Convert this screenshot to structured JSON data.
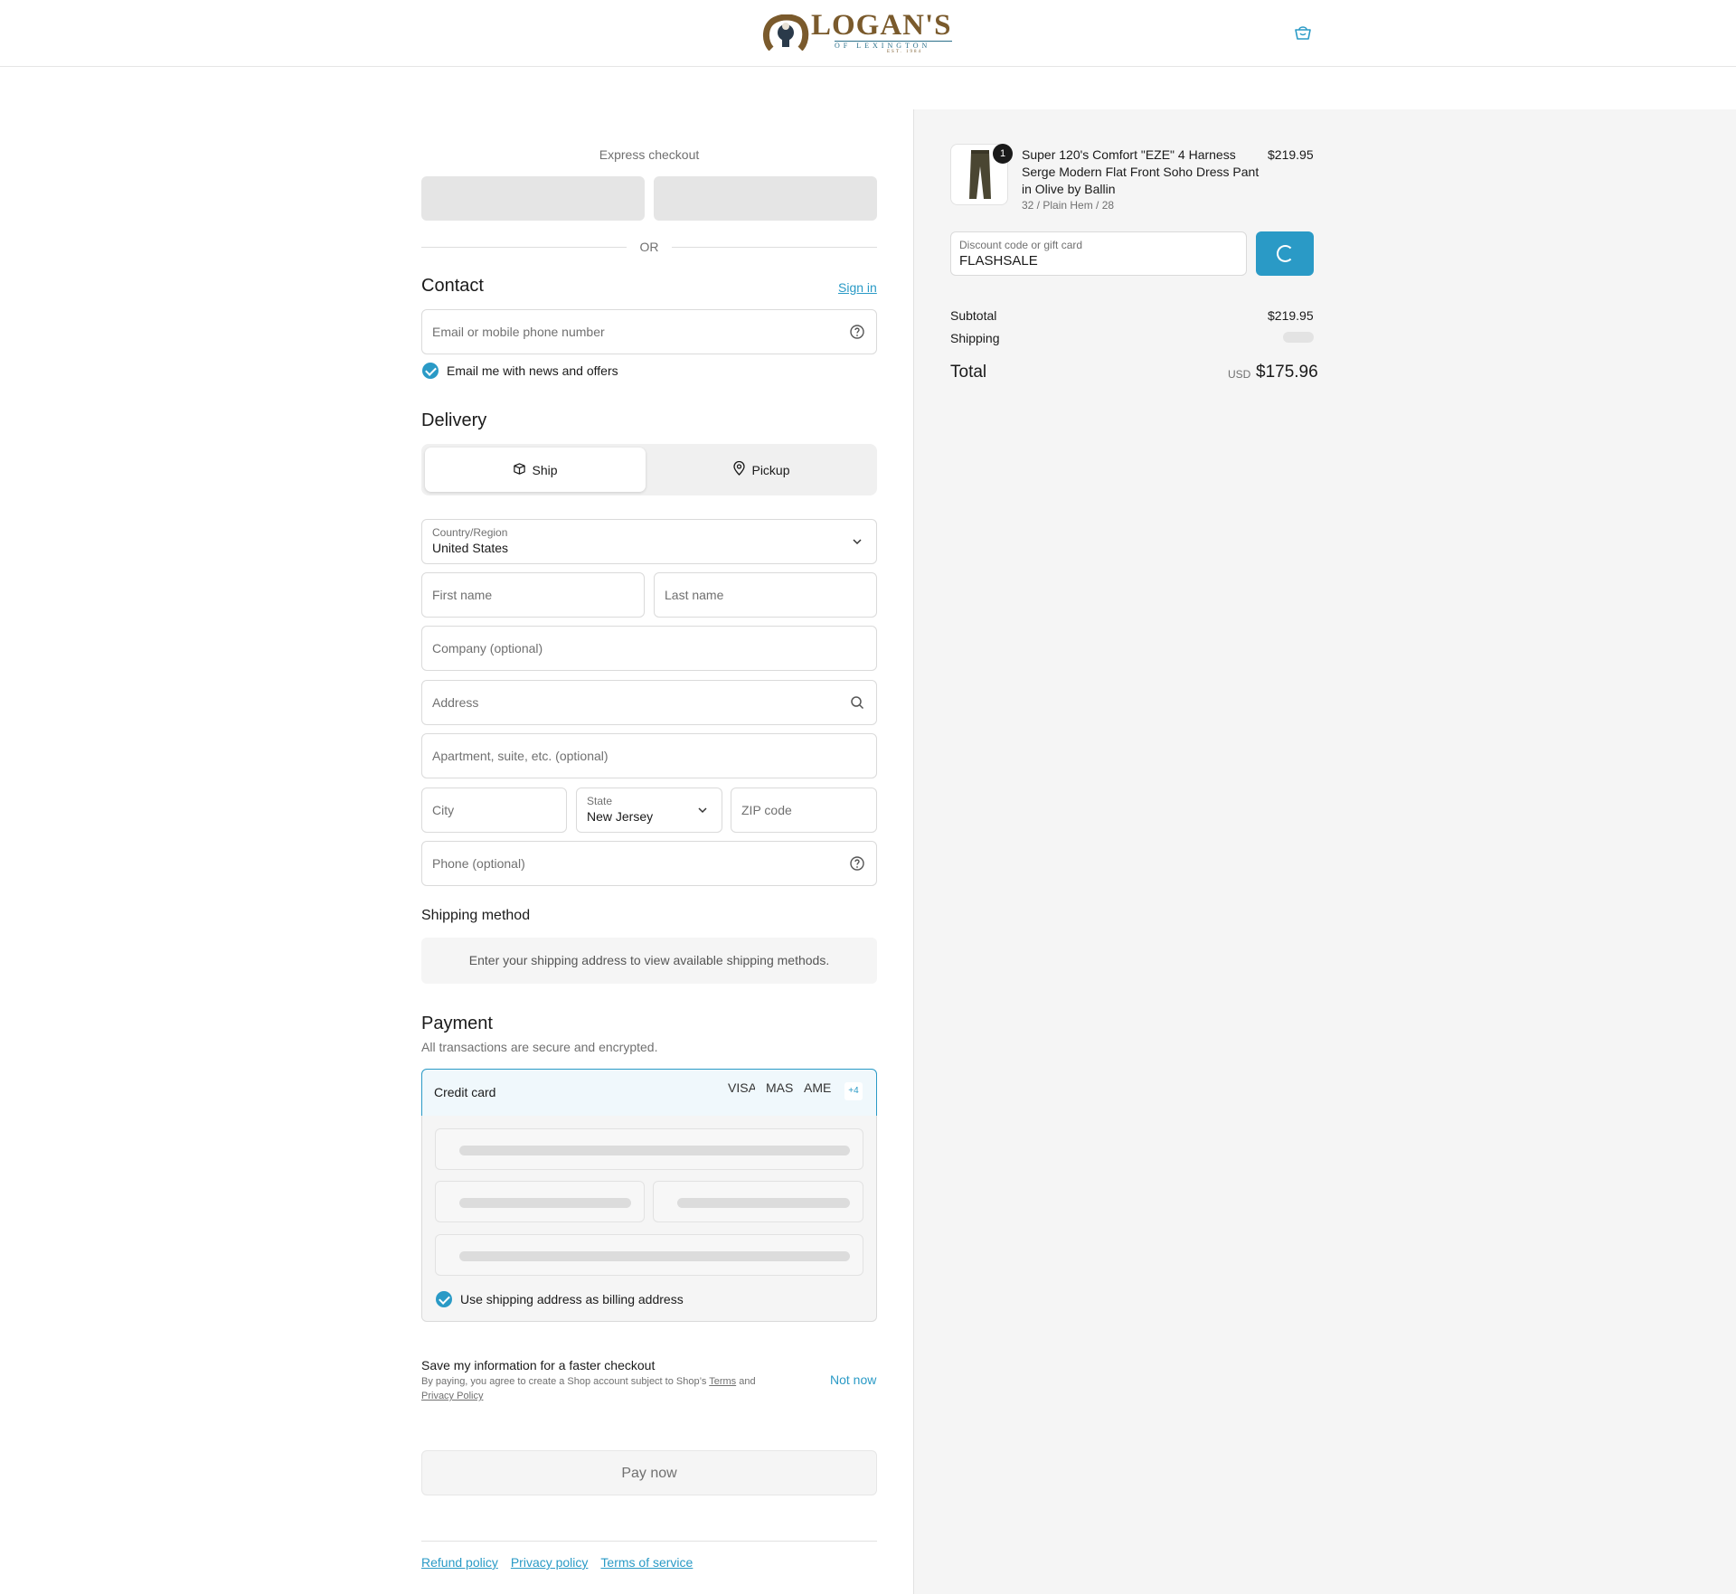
{
  "header": {
    "logo": {
      "main": "LOGAN'S",
      "sub": "OF LEXINGTON",
      "est": "EST. 1984"
    },
    "cart_icon": "cart-icon"
  },
  "express": {
    "title": "Express checkout",
    "or": "OR"
  },
  "contact": {
    "title": "Contact",
    "sign_in": "Sign in",
    "email_placeholder": "Email or mobile phone number",
    "newsletter_label": "Email me with news and offers",
    "newsletter_checked": true
  },
  "delivery": {
    "title": "Delivery",
    "ship_label": "Ship",
    "pickup_label": "Pickup",
    "selected": "Ship",
    "country_label": "Country/Region",
    "country_value": "United States",
    "first_name_placeholder": "First name",
    "last_name_placeholder": "Last name",
    "company_placeholder": "Company (optional)",
    "address_placeholder": "Address",
    "apartment_placeholder": "Apartment, suite, etc. (optional)",
    "city_placeholder": "City",
    "state_label": "State",
    "state_value": "New Jersey",
    "zip_placeholder": "ZIP code",
    "phone_placeholder": "Phone (optional)"
  },
  "shipping_method": {
    "title": "Shipping method",
    "message": "Enter your shipping address to view available shipping methods."
  },
  "payment": {
    "title": "Payment",
    "subtitle": "All transactions are secure and encrypted.",
    "method_label": "Credit card",
    "card_logos": [
      "VISA",
      "MASTER",
      "AMEX"
    ],
    "more_cards": "+4",
    "billing_label": "Use shipping address as billing address",
    "billing_checked": true
  },
  "save_info": {
    "title": "Save my information for a faster checkout",
    "fine_prefix": "By paying, you agree to create a Shop account subject to Shop’s ",
    "terms": "Terms",
    "and": " and ",
    "privacy": "Privacy Policy",
    "not_now": "Not now"
  },
  "pay_now": "Pay now",
  "footer": {
    "links": [
      "Refund policy",
      "Privacy policy",
      "Terms of service"
    ]
  },
  "summary": {
    "product": {
      "name": "Super 120's Comfort \"EZE\" 4 Harness Serge Modern Flat Front Soho Dress Pant in Olive by Ballin",
      "variant": "32 / Plain Hem / 28",
      "price": "$219.95",
      "quantity": "1"
    },
    "discount_label": "Discount code or gift card",
    "discount_value": "FLASHSALE",
    "subtotal_label": "Subtotal",
    "subtotal_value": "$219.95",
    "shipping_label": "Shipping",
    "total_label": "Total",
    "currency": "USD",
    "total_value": "$175.96"
  },
  "colors": {
    "accent": "#2a9ac6",
    "brand_brown": "#7a5a2c",
    "panel_bg": "#f5f5f5"
  }
}
